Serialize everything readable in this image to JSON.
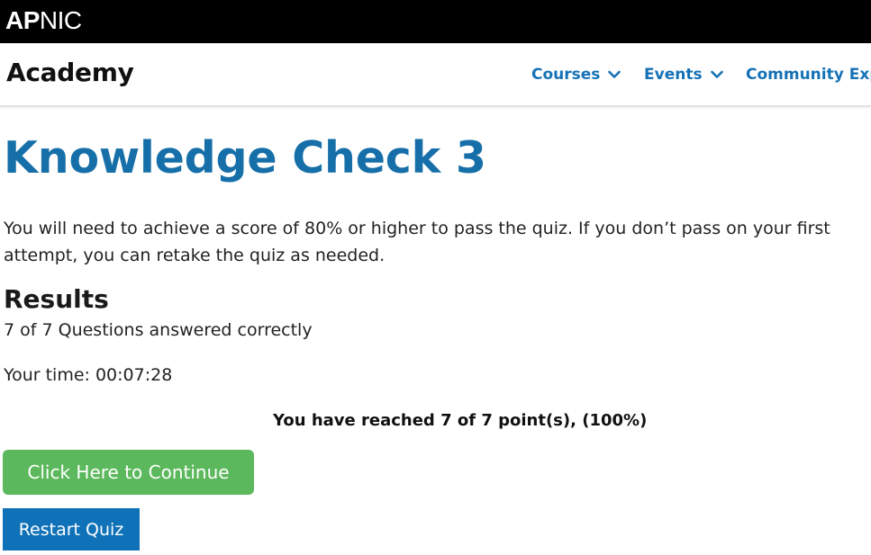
{
  "header": {
    "logo_bold": "AP",
    "logo_light": "NIC"
  },
  "nav": {
    "brand": "Academy",
    "items": [
      {
        "label": "Courses",
        "icon": "chevron-down-icon"
      },
      {
        "label": "Events",
        "icon": "chevron-down-icon"
      },
      {
        "label": "Community Expe"
      }
    ]
  },
  "main": {
    "title": "Knowledge Check 3",
    "intro": "You will need to achieve a score of 80% or higher to pass the quiz. If you don’t pass on your first attempt, you can retake the quiz as needed.",
    "results_heading": "Results",
    "results_count": "7 of 7 Questions answered correctly",
    "time_label": "Your time: 00:07:28",
    "points_text": "You have reached 7 of 7 point(s), (100%)",
    "continue_label": "Click Here to Continue",
    "restart_label": "Restart Quiz"
  },
  "colors": {
    "accent_blue": "#166fa8",
    "continue_green": "#5cb85c",
    "restart_blue": "#0f72b8",
    "topbar_black": "#000000"
  }
}
